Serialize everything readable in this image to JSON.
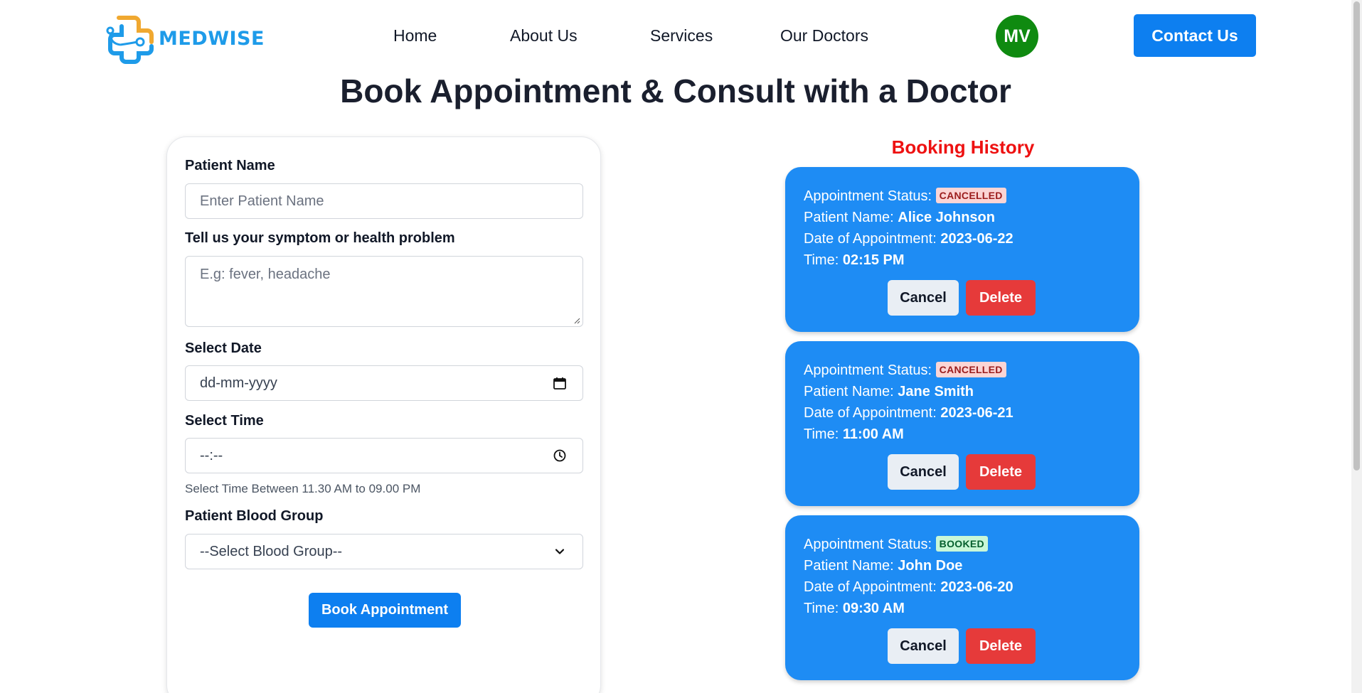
{
  "brand": {
    "name": "MEDWISE",
    "accent": "#1e9be9",
    "accent_secondary": "#f0a830"
  },
  "nav": {
    "items": [
      {
        "label": "Home"
      },
      {
        "label": "About Us"
      },
      {
        "label": "Services"
      },
      {
        "label": "Our Doctors"
      }
    ],
    "avatar_initials": "MV",
    "contact_label": "Contact Us"
  },
  "page": {
    "title": "Book Appointment & Consult with a Doctor"
  },
  "form": {
    "patient_name_label": "Patient Name",
    "patient_name_placeholder": "Enter Patient Name",
    "symptom_label": "Tell us your symptom or health problem",
    "symptom_placeholder": "E.g: fever, headache",
    "date_label": "Select Date",
    "date_value": "dd-mm-yyyy",
    "time_label": "Select Time",
    "time_value": "--:--",
    "time_hint": "Select Time Between 11.30 AM to 09.00 PM",
    "blood_group_label": "Patient Blood Group",
    "blood_group_selected": "--Select Blood Group--",
    "submit_label": "Book Appointment"
  },
  "history": {
    "title": "Booking History",
    "status_label": "Appointment Status:",
    "patient_label": "Patient Name:",
    "date_label": "Date of Appointment:",
    "time_label": "Time:",
    "cancel_label": "Cancel",
    "delete_label": "Delete",
    "bookings": [
      {
        "status": "CANCELLED",
        "patient": "Alice Johnson",
        "date": "2023-06-22",
        "time": "02:15 PM"
      },
      {
        "status": "CANCELLED",
        "patient": "Jane Smith",
        "date": "2023-06-21",
        "time": "11:00 AM"
      },
      {
        "status": "BOOKED",
        "patient": "John Doe",
        "date": "2023-06-20",
        "time": "09:30 AM"
      }
    ]
  },
  "colors": {
    "primary_button": "#0d7ff0",
    "card_blue": "#1e8cf4",
    "delete_red": "#e63a3a",
    "history_title": "#ee1111",
    "avatar_green": "#0f8a10"
  }
}
